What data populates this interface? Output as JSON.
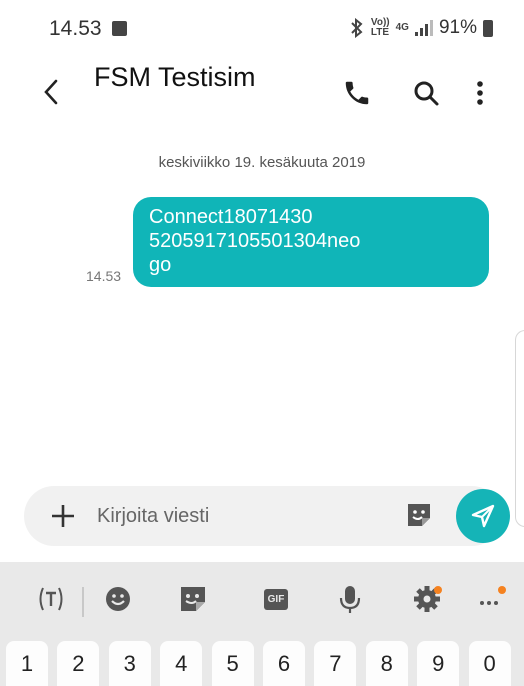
{
  "status_bar": {
    "time": "14.53",
    "volte": "Vo))\nLTE",
    "network": "4G",
    "battery": "91%"
  },
  "header": {
    "title": "FSM Testisim"
  },
  "conversation": {
    "date": "keskiviikko 19. kesäkuuta 2019",
    "messages": [
      {
        "text": "Connect18071430\n5205917105501304neo\ngo",
        "time": "14.53",
        "color": "#10b5b8"
      }
    ]
  },
  "composer": {
    "placeholder": "Kirjoita viesti"
  },
  "keyboard": {
    "gif_label": "GIF",
    "number_row": [
      "1",
      "2",
      "3",
      "4",
      "5",
      "6",
      "7",
      "8",
      "9",
      "0"
    ],
    "accent": "#f58220"
  },
  "colors": {
    "bubble": "#10b5b8",
    "send_button": "#15b4b7"
  }
}
